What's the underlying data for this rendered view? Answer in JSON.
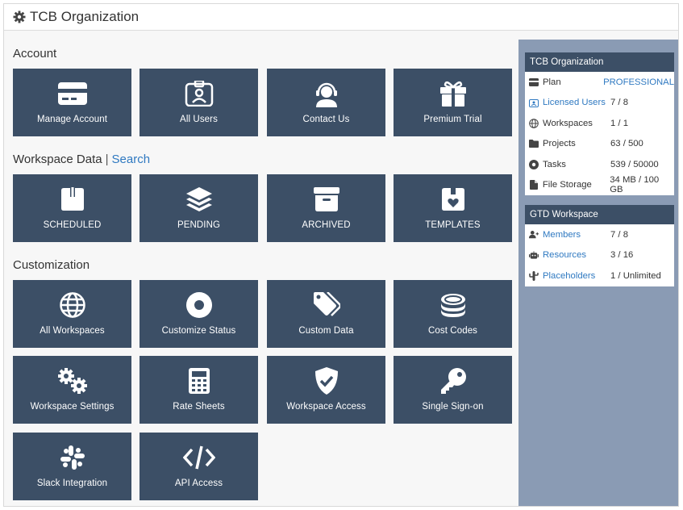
{
  "header": {
    "title": "TCB Organization",
    "icon": "gear-icon"
  },
  "sections": {
    "account": {
      "label": "Account"
    },
    "workspace_data": {
      "label": "Workspace Data",
      "separator": "|",
      "search_link": "Search"
    },
    "customization": {
      "label": "Customization"
    }
  },
  "tiles": {
    "manage_account": {
      "label": "Manage Account",
      "icon": "credit-card-icon"
    },
    "all_users": {
      "label": "All Users",
      "icon": "id-badge-icon"
    },
    "contact_us": {
      "label": "Contact Us",
      "icon": "headset-icon"
    },
    "premium_trial": {
      "label": "Premium Trial",
      "icon": "gift-icon"
    },
    "scheduled": {
      "label": "SCHEDULED",
      "icon": "box-open-icon"
    },
    "pending": {
      "label": "PENDING",
      "icon": "layers-icon"
    },
    "archived": {
      "label": "ARCHIVED",
      "icon": "archive-icon"
    },
    "templates": {
      "label": "TEMPLATES",
      "icon": "box-heart-icon"
    },
    "all_workspaces": {
      "label": "All Workspaces",
      "icon": "globe-icon"
    },
    "customize_status": {
      "label": "Customize Status",
      "icon": "dot-circle-icon"
    },
    "custom_data": {
      "label": "Custom Data",
      "icon": "tags-icon"
    },
    "cost_codes": {
      "label": "Cost Codes",
      "icon": "coins-icon"
    },
    "workspace_settings": {
      "label": "Workspace Settings",
      "icon": "gears-icon"
    },
    "rate_sheets": {
      "label": "Rate Sheets",
      "icon": "calculator-icon"
    },
    "workspace_access": {
      "label": "Workspace Access",
      "icon": "shield-check-icon"
    },
    "single_sign_on": {
      "label": "Single Sign-on",
      "icon": "key-icon"
    },
    "slack_integration": {
      "label": "Slack Integration",
      "icon": "slack-icon"
    },
    "api_access": {
      "label": "API Access",
      "icon": "code-icon"
    }
  },
  "org_panel": {
    "title": "TCB Organization",
    "rows": [
      {
        "label": "Plan",
        "value": "PROFESSIONAL",
        "icon": "credit-card-icon"
      },
      {
        "label": "Licensed Users",
        "value": "7 / 8",
        "icon": "id-badge-icon"
      },
      {
        "label": "Workspaces",
        "value": "1 / 1",
        "icon": "globe-icon"
      },
      {
        "label": "Projects",
        "value": "63 / 500",
        "icon": "folder-icon"
      },
      {
        "label": "Tasks",
        "value": "539 / 50000",
        "icon": "dot-circle-icon"
      },
      {
        "label": "File Storage",
        "value": "34 MB / 100 GB",
        "icon": "file-icon"
      }
    ]
  },
  "workspace_panel": {
    "title": "GTD Workspace",
    "rows": [
      {
        "label": "Members",
        "value": "7 / 8",
        "icon": "user-plus-icon"
      },
      {
        "label": "Resources",
        "value": "3 / 16",
        "icon": "robot-icon"
      },
      {
        "label": "Placeholders",
        "value": "1 / Unlimited",
        "icon": "cactus-icon"
      }
    ]
  },
  "colors": {
    "tile_bg": "#3c4f66",
    "sidebar_bg": "#8a9bb4",
    "link": "#2f79c1"
  }
}
